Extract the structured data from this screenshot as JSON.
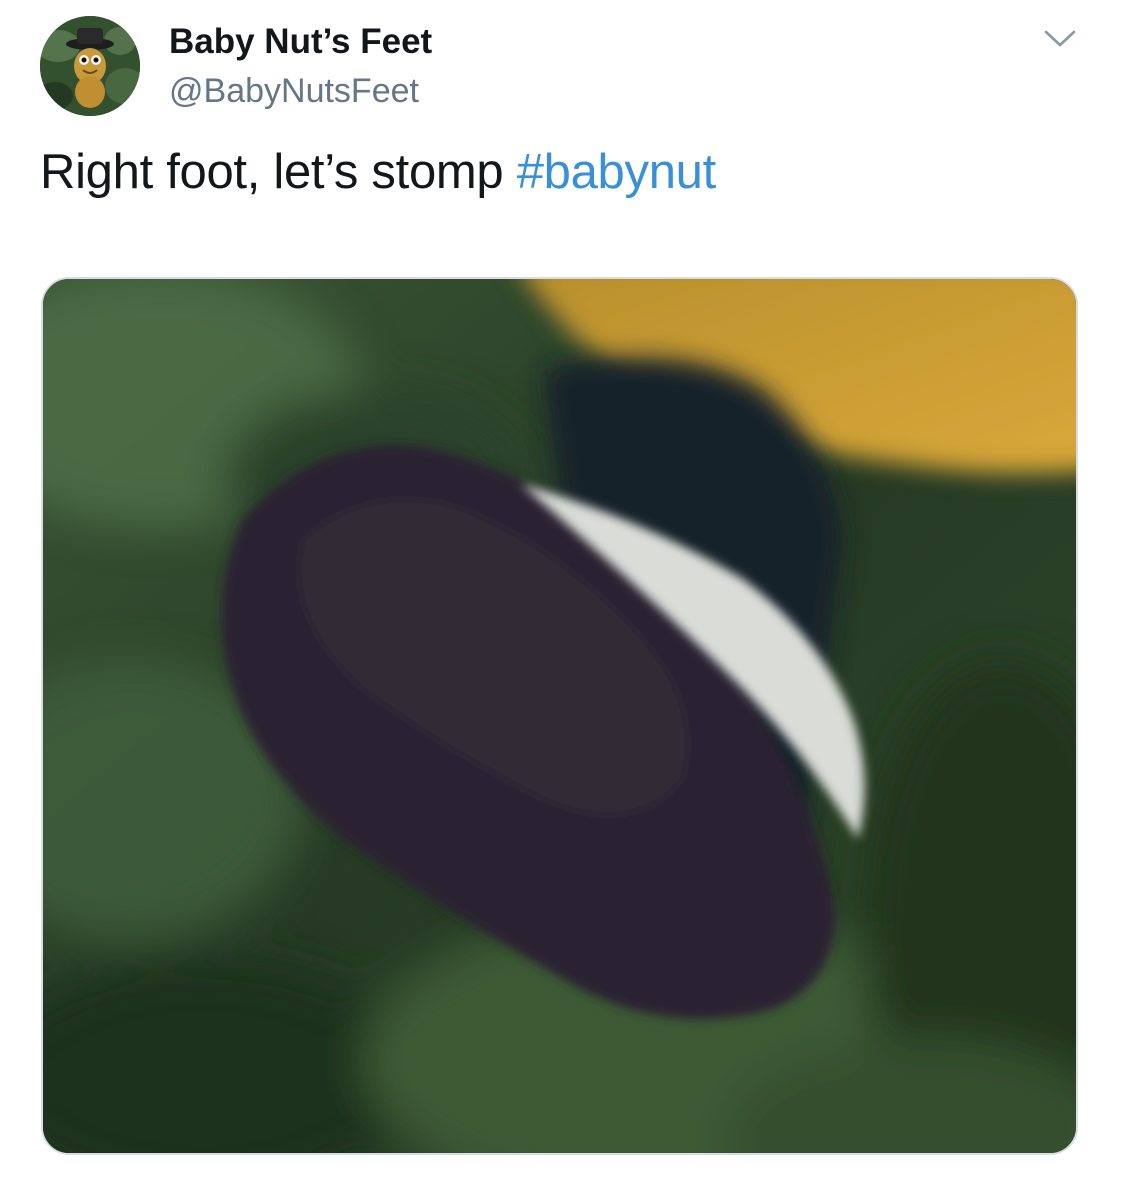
{
  "tweet": {
    "author": {
      "display_name": "Baby Nut’s Feet",
      "handle": "@BabyNutsFeet",
      "avatar_icon": "peanut-mascot-avatar"
    },
    "text": "Right foot, let’s stomp ",
    "hashtag": "#babynut",
    "menu_icon": "chevron-down-icon",
    "media": {
      "type": "photo",
      "description_icon": "blurry-foot-photo"
    }
  },
  "colors": {
    "text": "#14171a",
    "secondary_text": "#657786",
    "link": "#3a8fd9",
    "border": "#d7dde2"
  }
}
